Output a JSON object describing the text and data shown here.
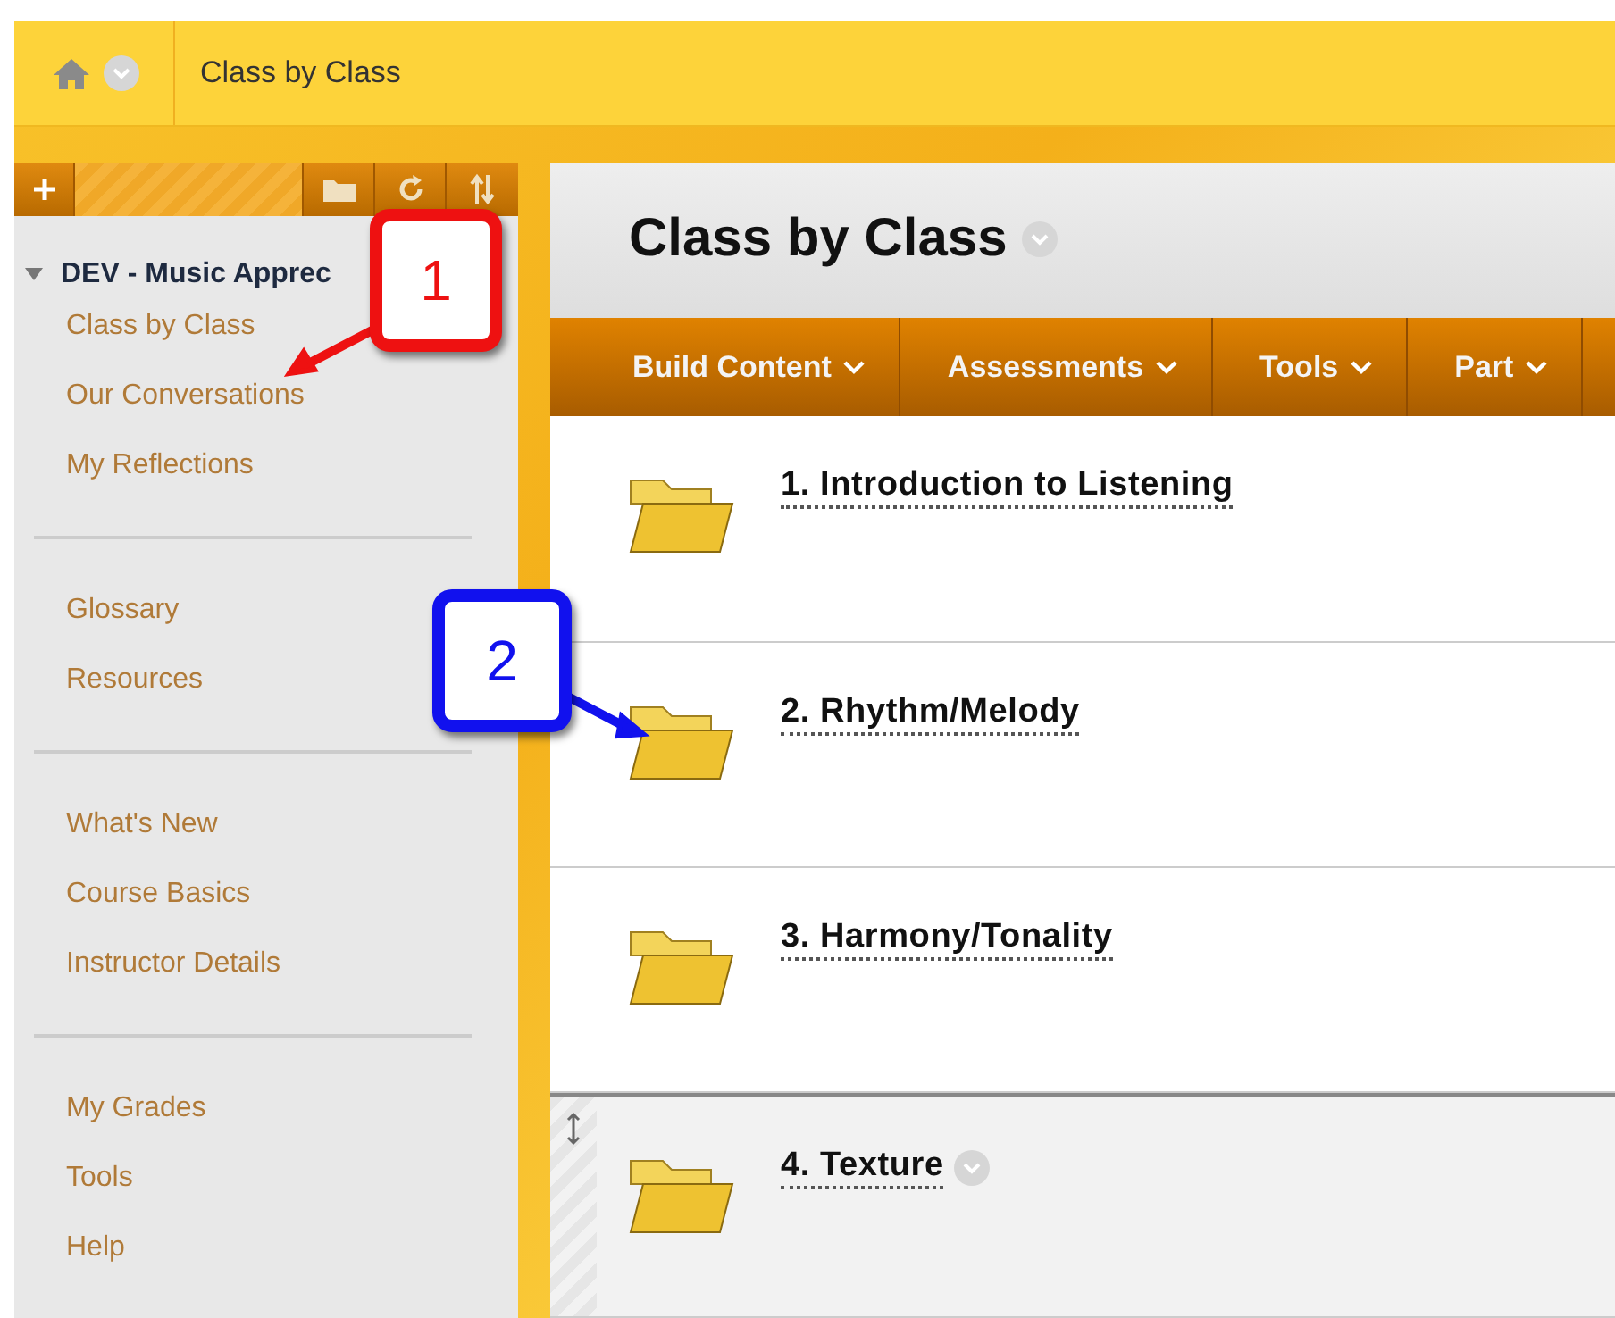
{
  "breadcrumb": {
    "title": "Class by Class"
  },
  "sidebar": {
    "course": "DEV - Music Apprec",
    "groups": [
      {
        "items": [
          {
            "label": "Class by Class"
          },
          {
            "label": "Our Conversations"
          },
          {
            "label": "My Reflections"
          }
        ]
      },
      {
        "items": [
          {
            "label": "Glossary"
          },
          {
            "label": "Resources"
          }
        ]
      },
      {
        "items": [
          {
            "label": "What's New"
          },
          {
            "label": "Course Basics"
          },
          {
            "label": "Instructor Details"
          }
        ]
      },
      {
        "items": [
          {
            "label": "My Grades"
          },
          {
            "label": "Tools"
          },
          {
            "label": "Help"
          }
        ]
      }
    ]
  },
  "content": {
    "title": "Class by Class",
    "menu": [
      {
        "label": "Build Content"
      },
      {
        "label": "Assessments"
      },
      {
        "label": "Tools"
      },
      {
        "label": "Part"
      }
    ],
    "items": [
      {
        "title": "1. Introduction to Listening",
        "highlighted": false
      },
      {
        "title": "2. Rhythm/Melody",
        "highlighted": false
      },
      {
        "title": "3. Harmony/Tonality",
        "highlighted": false
      },
      {
        "title": "4. Texture",
        "highlighted": true
      }
    ]
  },
  "callouts": [
    {
      "label": "1",
      "color": "#ee1111"
    },
    {
      "label": "2",
      "color": "#1111ee"
    }
  ]
}
